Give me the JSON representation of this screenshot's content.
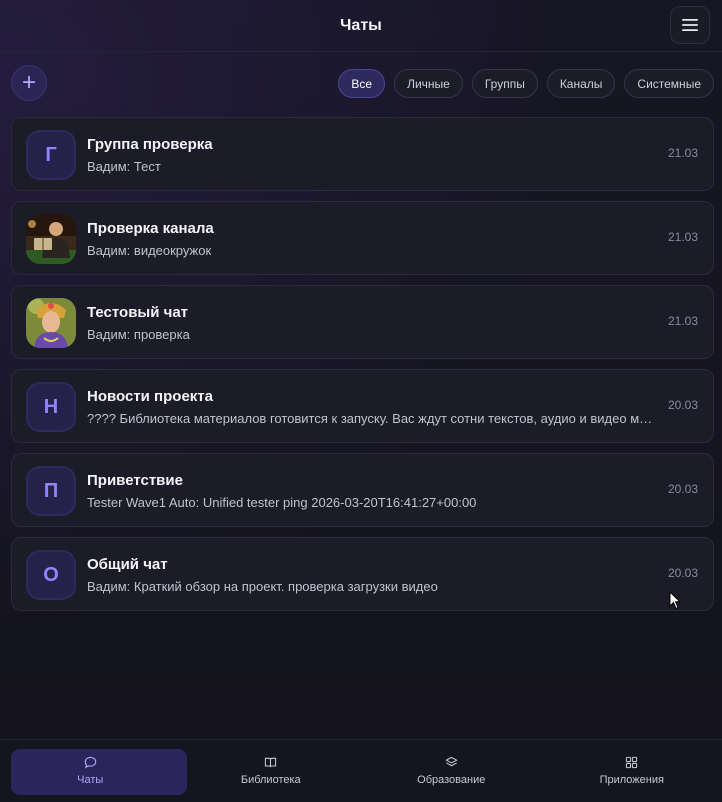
{
  "header": {
    "title": "Чаты"
  },
  "toolbar": {
    "add_label": "+",
    "filters": [
      "Все",
      "Личные",
      "Группы",
      "Каналы",
      "Системные"
    ],
    "active_filter": "Все"
  },
  "chats": [
    {
      "name": "Группа проверка",
      "preview": "Вадим: Тест",
      "date": "21.03",
      "avatar_letter": "Г"
    },
    {
      "name": "Проверка канала",
      "preview": "Вадим: видеокружок",
      "date": "21.03",
      "avatar_letter": ""
    },
    {
      "name": "Тестовый чат",
      "preview": "Вадим: проверка",
      "date": "21.03",
      "avatar_letter": ""
    },
    {
      "name": "Новости проекта",
      "preview": "???? Библиотека материалов готовится к запуску. Вас ждут сотни текстов, аудио и видео материалов",
      "date": "20.03",
      "avatar_letter": "Н"
    },
    {
      "name": "Приветствие",
      "preview": "Tester Wave1 Auto: Unified tester ping 2026-03-20T16:41:27+00:00",
      "date": "20.03",
      "avatar_letter": "П"
    },
    {
      "name": "Общий чат",
      "preview": "Вадим: Краткий обзор на проект. проверка загрузки видео",
      "date": "20.03",
      "avatar_letter": "О"
    }
  ],
  "bottom_nav": [
    {
      "label": "Чаты",
      "icon": "chat-bubble-icon",
      "active": true
    },
    {
      "label": "Библиотека",
      "icon": "book-icon",
      "active": false
    },
    {
      "label": "Образование",
      "icon": "layers-icon",
      "active": false
    },
    {
      "label": "Приложения",
      "icon": "grid-icon",
      "active": false
    }
  ],
  "colors": {
    "accent": "#8f84ff",
    "active_bg": "#2f2a5e",
    "background": "#14141f"
  }
}
